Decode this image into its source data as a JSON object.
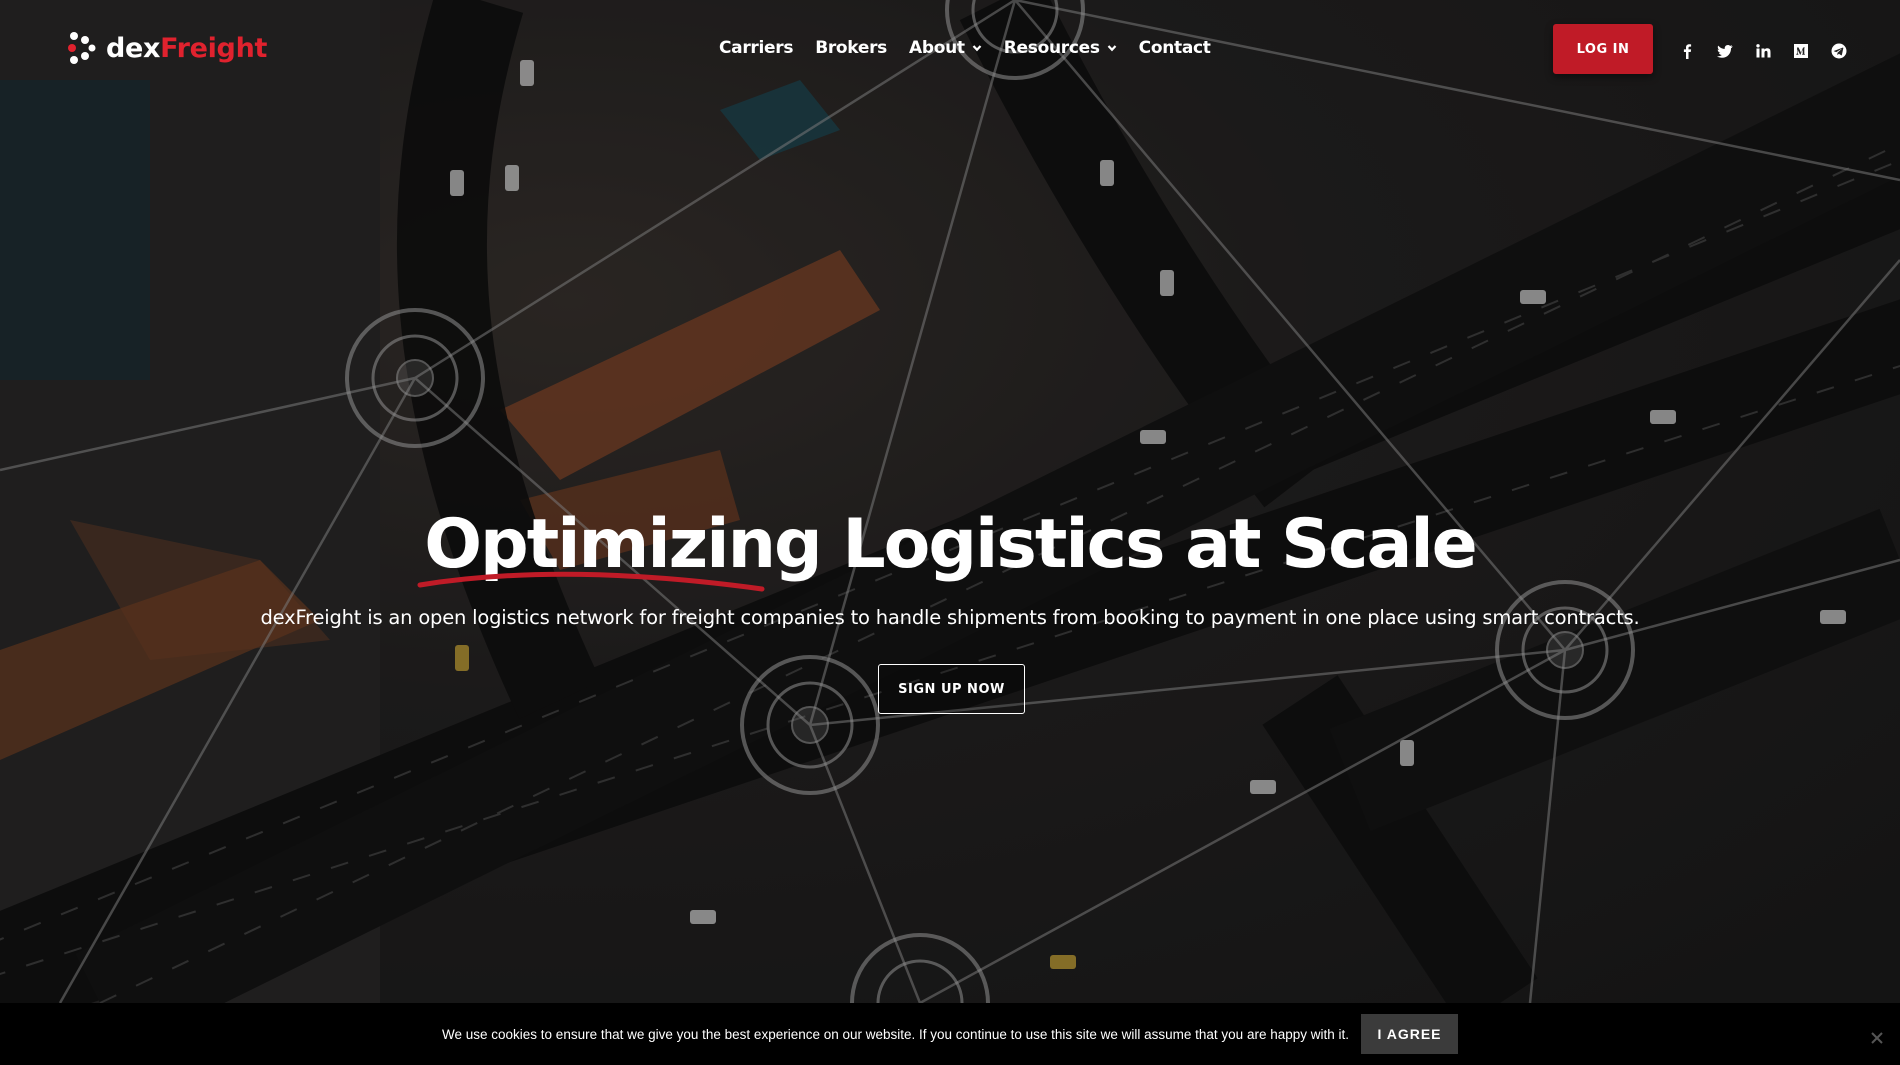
{
  "brand": {
    "name_part1": "dex",
    "name_part2": "Freight",
    "accent": "#e0222e"
  },
  "nav": {
    "items": [
      {
        "label": "Carriers",
        "has_dropdown": false
      },
      {
        "label": "Brokers",
        "has_dropdown": false
      },
      {
        "label": "About",
        "has_dropdown": true
      },
      {
        "label": "Resources",
        "has_dropdown": true
      },
      {
        "label": "Contact",
        "has_dropdown": false
      }
    ]
  },
  "header": {
    "login_label": "LOG IN",
    "login_color": "#c01b27",
    "socials": [
      "facebook-icon",
      "twitter-icon",
      "linkedin-icon",
      "medium-icon",
      "telegram-icon"
    ]
  },
  "hero": {
    "headline_emphasis": "Optimizing",
    "headline_rest": " Logistics at Scale",
    "subhead": "dexFreight is an open logistics network for freight companies to handle shipments from booking to payment in one place using smart contracts.",
    "cta_label": "SIGN UP NOW"
  },
  "cookie": {
    "text": "We use cookies to ensure that we give you the best experience on our website. If you continue to use this site we will assume that you are happy with it.",
    "agree_label": "I AGREE"
  }
}
